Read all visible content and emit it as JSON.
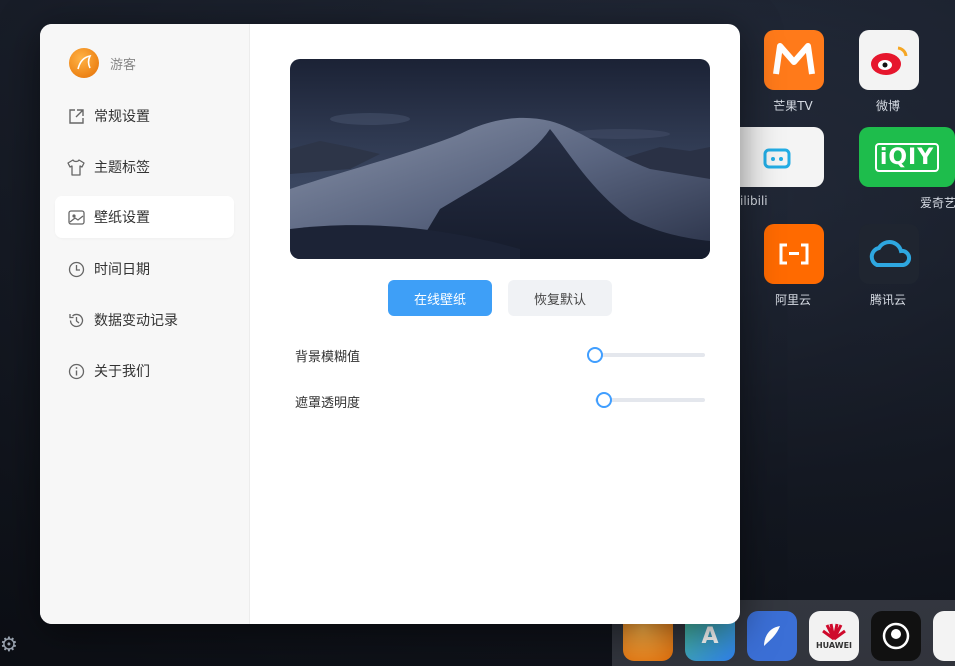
{
  "desktop": {
    "apps": [
      {
        "label": "芒果TV"
      },
      {
        "label": "微博"
      },
      {
        "label": "bilibili"
      },
      {
        "label": "爱奇艺"
      },
      {
        "label": "阿里云"
      },
      {
        "label": "腾讯云"
      }
    ],
    "dock": [
      "HUAWEI"
    ]
  },
  "modal": {
    "user": {
      "name": "游客"
    },
    "menu": [
      {
        "label": "常规设置",
        "icon": "external-link-icon"
      },
      {
        "label": "主题标签",
        "icon": "tshirt-icon"
      },
      {
        "label": "壁纸设置",
        "icon": "image-icon",
        "active": true
      },
      {
        "label": "时间日期",
        "icon": "clock-icon"
      },
      {
        "label": "数据变动记录",
        "icon": "history-icon"
      },
      {
        "label": "关于我们",
        "icon": "info-icon"
      }
    ],
    "wallpaper": {
      "online_button": "在线壁纸",
      "reset_button": "恢复默认",
      "blur_label": "背景模糊值",
      "blur_value": 0,
      "mask_label": "遮罩透明度",
      "mask_value": 0.08
    }
  },
  "colors": {
    "accent": "#409eff",
    "primary_button": "#3e9ff7"
  }
}
